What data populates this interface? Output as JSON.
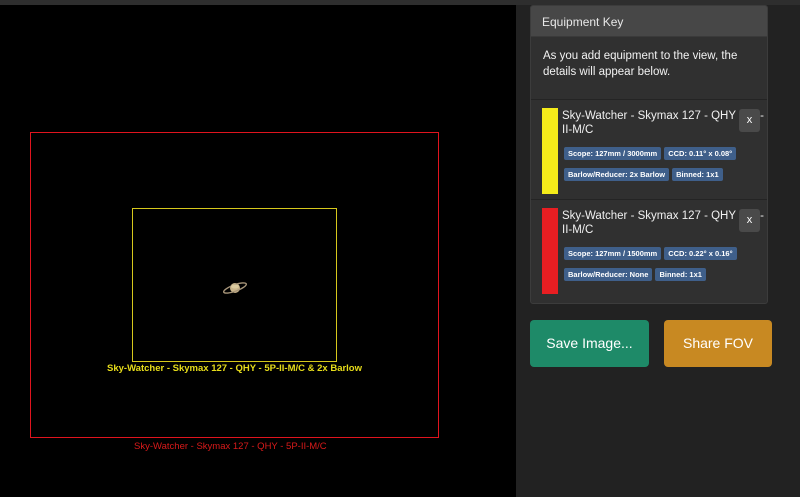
{
  "viewer": {
    "fov_labels": {
      "yellow": "Sky-Watcher - Skymax 127 - QHY - 5P-II-M/C  & 2x Barlow",
      "red": "Sky-Watcher - Skymax 127 - QHY - 5P-II-M/C"
    },
    "colors": {
      "yellow": "#d6c81c",
      "red": "#e0141e"
    }
  },
  "equipment_key": {
    "title": "Equipment Key",
    "intro": "As you add equipment to the view, the details will appear below.",
    "items": [
      {
        "name": "Sky-Watcher - Skymax 127 - QHY - 5P-II-M/C",
        "color": "#f5ec1a",
        "remove_label": "x",
        "tags": [
          "Scope: 127mm / 3000mm",
          "CCD: 0.11° x 0.08°",
          "Barlow/Reducer: 2x Barlow",
          "Binned: 1x1"
        ]
      },
      {
        "name": "Sky-Watcher - Skymax 127 - QHY - 5P-II-M/C",
        "color": "#e81e22",
        "remove_label": "x",
        "tags": [
          "Scope: 127mm / 1500mm",
          "CCD: 0.22° x 0.16°",
          "Barlow/Reducer: None",
          "Binned: 1x1"
        ]
      }
    ]
  },
  "actions": {
    "save_label": "Save Image...",
    "share_label": "Share FOV"
  }
}
